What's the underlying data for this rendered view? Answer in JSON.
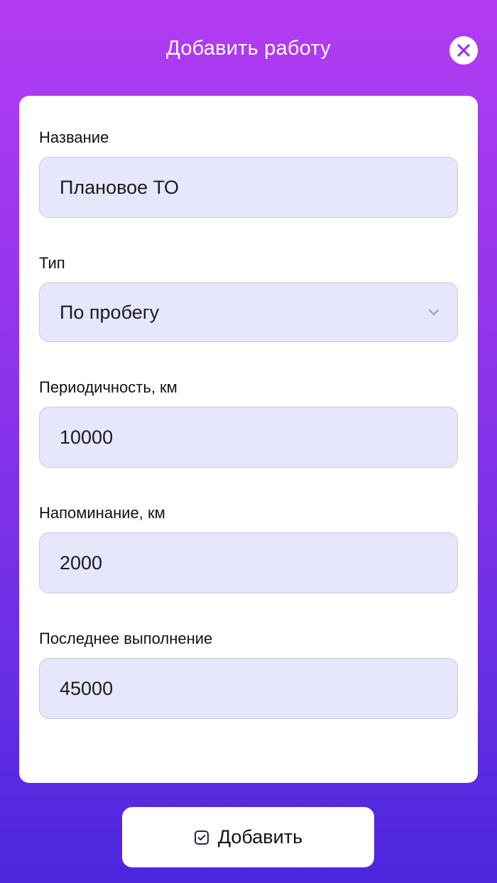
{
  "header": {
    "title": "Добавить работу"
  },
  "form": {
    "name": {
      "label": "Название",
      "value": "Плановое ТО"
    },
    "type": {
      "label": "Тип",
      "value": "По пробегу"
    },
    "interval": {
      "label": "Периодичность, км",
      "value": "10000"
    },
    "reminder": {
      "label": "Напоминание, км",
      "value": "2000"
    },
    "last_done": {
      "label": "Последнее выполнение",
      "value": "45000"
    }
  },
  "footer": {
    "add_label": "Добавить"
  },
  "icons": {
    "close": "close-icon",
    "chevron": "chevron-down-icon",
    "check": "checkbox-check-icon"
  },
  "colors": {
    "accent": "#9b35ed",
    "field_bg": "#e6e7fa",
    "gradient_top": "#b33cf3",
    "gradient_bottom": "#4b26dd"
  }
}
